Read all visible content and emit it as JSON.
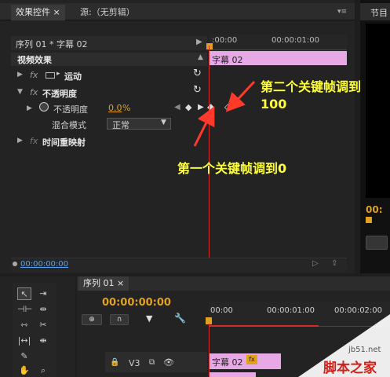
{
  "effect_controls": {
    "tabs": [
      "效果控件 ×",
      "源:（无剪辑）"
    ],
    "sequence_label": "序列 01 * 字幕 02",
    "ruler_start": ":00:00",
    "ruler_mid": "00:00:01:00",
    "section_title": "视频效果",
    "rows": {
      "motion": "运动",
      "opacity": "不透明度",
      "opacity_param": "不透明度",
      "opacity_value": "0.0",
      "opacity_unit": "%",
      "blend_mode_label": "混合模式",
      "blend_mode_value": "正常",
      "time_remap": "时间重映射"
    },
    "clip_label": "字幕 02",
    "fx_label": "fx",
    "current_time": "00:00:00:00"
  },
  "right_panel": {
    "tab": "节目",
    "timecode": "00:"
  },
  "annotations": {
    "second_line1": "第二个关键帧调到",
    "second_line2": "100",
    "first": "第一个关键帧调到0"
  },
  "timeline": {
    "tab": "序列 01 ×",
    "timecode": "00:00:00:00",
    "ruler": [
      "00:00",
      "00:00:01:00",
      "00:00:02:00"
    ],
    "track": {
      "name": "V3",
      "clip": "字幕 02",
      "fx": "fx"
    }
  },
  "watermark": {
    "site": "jb51.net",
    "name": "脚本之家"
  },
  "colors": {
    "playhead": "#d42a2a",
    "clip": "#e6a9e6",
    "annotation_text": "#ffff3b",
    "arrow": "#ff3a2a",
    "timecode_amber": "#e0a020",
    "timecode_blue": "#5aa0f0"
  }
}
